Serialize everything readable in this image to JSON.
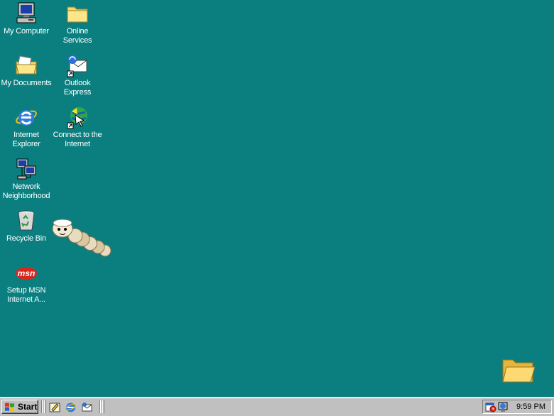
{
  "desktop": {
    "background_color": "#0b7f80",
    "icons": [
      {
        "label": "My Computer",
        "icon": "my-computer-icon"
      },
      {
        "label": "Online Services",
        "icon": "folder-icon"
      },
      {
        "label": "My Documents",
        "icon": "my-documents-icon"
      },
      {
        "label": "Outlook Express",
        "icon": "outlook-express-icon"
      },
      {
        "label": "Internet Explorer",
        "icon": "internet-explorer-icon"
      },
      {
        "label": "Connect to the Internet",
        "icon": "connect-internet-icon"
      },
      {
        "label": "Network Neighborhood",
        "icon": "network-neighborhood-icon"
      },
      {
        "label": "Recycle Bin",
        "icon": "recycle-bin-icon"
      },
      {
        "label": "Setup MSN Internet A...",
        "icon": "msn-icon"
      }
    ],
    "msn_logo_text": "msn",
    "pet": "caterpillar-desktop-pet",
    "extra_folder": "folder-icon"
  },
  "taskbar": {
    "start_label": "Start",
    "quick_launch": [
      "show-desktop-icon",
      "internet-explorer-icon",
      "outlook-express-icon"
    ],
    "tray_icons": [
      "scheduler-icon",
      "network-status-icon"
    ],
    "clock": "9:59 PM"
  }
}
